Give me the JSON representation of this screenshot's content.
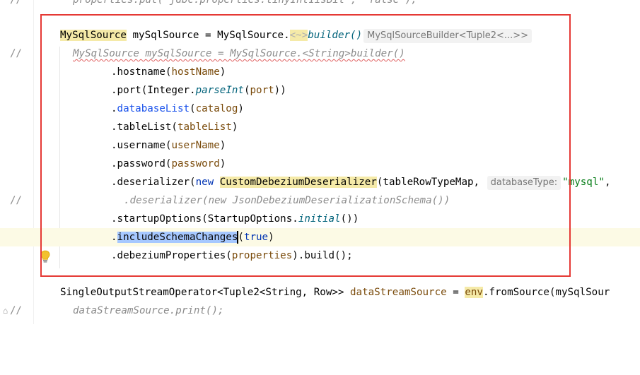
{
  "gutter": {
    "comment_marker": "//"
  },
  "code": {
    "line0": {
      "text": "properties.put(\"jdbc.properties.tinyInt1isBit\", \"false\");"
    },
    "line1": {
      "type": "MySqlSource",
      "var": "mySqlSource",
      "eq": " = ",
      "cls": "MySqlSource.",
      "generic": "<~>",
      "builder": "builder()",
      "hint": "MySqlSourceBuilder<Tuple2<...>>"
    },
    "line2": {
      "text": "MySqlSource mySqlSource = MySqlSource.<String>builder()"
    },
    "line3": {
      "dot": ".",
      "method": "hostname",
      "open": "(",
      "arg": "hostName",
      "close": ")"
    },
    "line4": {
      "dot": ".",
      "method": "port",
      "open": "(",
      "cls": "Integer.",
      "static": "parseInt",
      "open2": "(",
      "arg": "port",
      "close": "))"
    },
    "line5": {
      "dot": ".",
      "method": "databaseList",
      "open": "(",
      "arg": "catalog",
      "close": ")"
    },
    "line6": {
      "dot": ".",
      "method": "tableList",
      "open": "(",
      "arg": "tableList",
      "close": ")"
    },
    "line7": {
      "dot": ".",
      "method": "username",
      "open": "(",
      "arg": "userName",
      "close": ")"
    },
    "line8": {
      "dot": ".",
      "method": "password",
      "open": "(",
      "arg": "password",
      "close": ")"
    },
    "line9": {
      "dot": ".",
      "method": "deserializer",
      "open": "(",
      "kw": "new ",
      "cls": "CustomDebeziumDeserializer",
      "open2": "(",
      "arg": "tableRowTypeMap",
      "comma": ", ",
      "hint": "databaseType:",
      "str": "\"mysql\"",
      "tail": ","
    },
    "line10": {
      "text": ".deserializer(new JsonDebeziumDeserializationSchema())"
    },
    "line11": {
      "dot": ".",
      "method": "startupOptions",
      "open": "(",
      "cls": "StartupOptions.",
      "static": "initial",
      "close": "())"
    },
    "line12": {
      "dot": ".",
      "method": "includeSchemaChanges",
      "open": "(",
      "kw": "true",
      "close": ")"
    },
    "line13": {
      "dot": ".",
      "method": "debeziumProperties",
      "open": "(",
      "arg": "properties",
      "close": ").build();"
    },
    "line15": {
      "type": "SingleOutputStreamOperator",
      "gen": "<Tuple2<String, Row>>",
      "var": " dataStreamSource",
      "eq": " = ",
      "env": "env",
      "rest": ".fromSource(mySqlSour"
    },
    "line16": {
      "text": "dataStreamSource.print();"
    }
  }
}
